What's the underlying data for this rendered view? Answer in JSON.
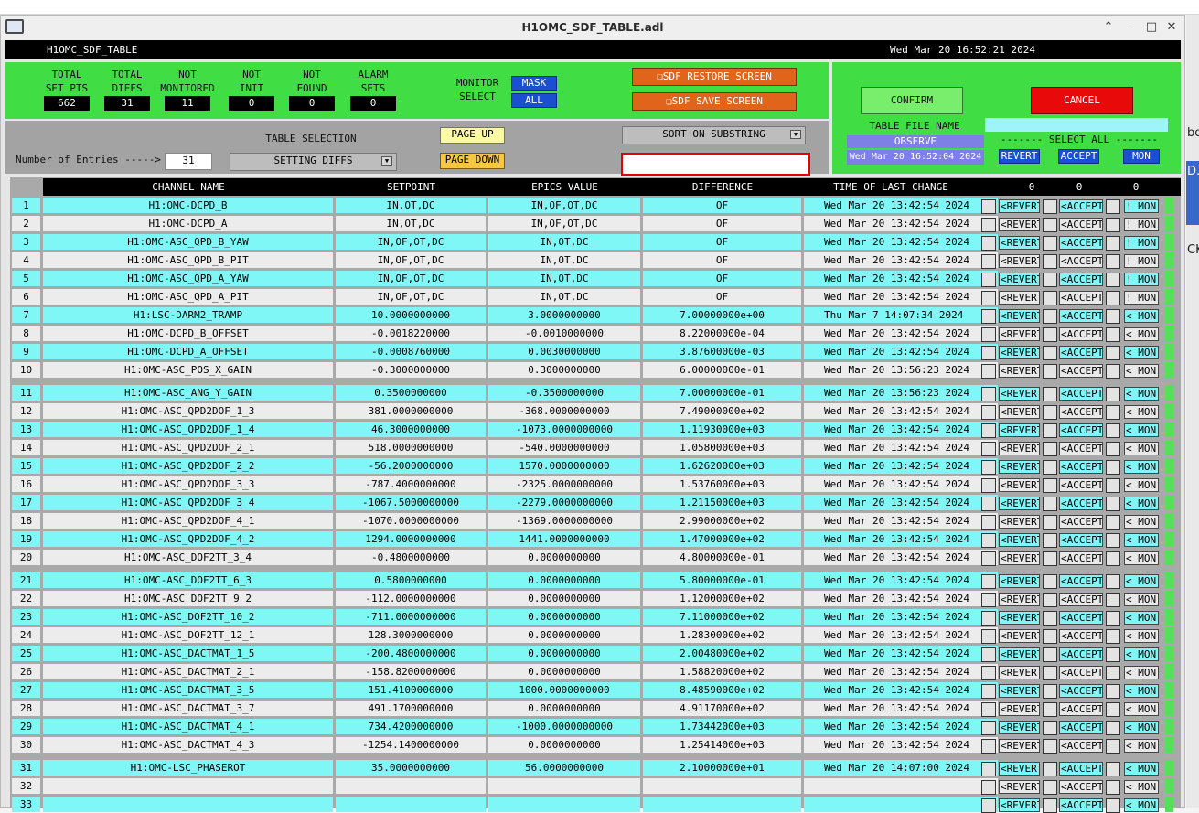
{
  "window": {
    "title": "H1OMC_SDF_TABLE.adl"
  },
  "header": {
    "screen_name": "H1OMC_SDF_TABLE",
    "datetime": "Wed Mar 20 16:52:21 2024"
  },
  "side_fragments": [
    "bo",
    "D.c",
    "CK"
  ],
  "stats": [
    {
      "label1": "TOTAL",
      "label2": "SET PTS",
      "value": "662"
    },
    {
      "label1": "TOTAL",
      "label2": "DIFFS",
      "value": "31"
    },
    {
      "label1": "NOT",
      "label2": "MONITORED",
      "value": "11"
    },
    {
      "label1": "NOT",
      "label2": "INIT",
      "value": "0"
    },
    {
      "label1": "NOT",
      "label2": "FOUND",
      "value": "0"
    },
    {
      "label1": "ALARM",
      "label2": "SETS",
      "value": "0"
    }
  ],
  "monitor": {
    "label1": "MONITOR",
    "label2": "SELECT",
    "mask": "MASK",
    "all": "ALL"
  },
  "buttons": {
    "restore": "SDF RESTORE SCREEN",
    "save": "SDF SAVE SCREEN",
    "confirm": "CONFIRM",
    "cancel": "CANCEL",
    "page_up": "PAGE UP",
    "page_down": "PAGE DOWN"
  },
  "table_file": {
    "label": "TABLE FILE NAME",
    "mode": "OBSERVE",
    "file_time": "Wed Mar 20 16:52:04 2024",
    "value": ""
  },
  "select_all": {
    "label": "------- SELECT ALL -------",
    "revert": "REVERT",
    "accept": "ACCEPT",
    "mon": "MON"
  },
  "table_selection": {
    "label": "TABLE SELECTION",
    "value": "SETTING DIFFS"
  },
  "entries": {
    "label": "Number of Entries ----->",
    "value": "31"
  },
  "sort": {
    "label": "SORT ON SUBSTRING",
    "value": ""
  },
  "columns": {
    "name": "CHANNEL NAME",
    "setpoint": "SETPOINT",
    "epics": "EPICS VALUE",
    "diff": "DIFFERENCE",
    "time": "TIME OF LAST CHANGE",
    "c1": "0",
    "c2": "0",
    "c3": "0"
  },
  "rows": [
    {
      "n": "1",
      "name": "H1:OMC-DCPD_B",
      "sp": "IN,OT,DC",
      "ev": "IN,OF,OT,DC",
      "diff": "OF",
      "time": "Wed Mar 20 13:42:54 2024",
      "mon": "! MON"
    },
    {
      "n": "2",
      "name": "H1:OMC-DCPD_A",
      "sp": "IN,OT,DC",
      "ev": "IN,OF,OT,DC",
      "diff": "OF",
      "time": "Wed Mar 20 13:42:54 2024",
      "mon": "! MON"
    },
    {
      "n": "3",
      "name": "H1:OMC-ASC_QPD_B_YAW",
      "sp": "IN,OF,OT,DC",
      "ev": "IN,OT,DC",
      "diff": "OF",
      "time": "Wed Mar 20 13:42:54 2024",
      "mon": "! MON"
    },
    {
      "n": "4",
      "name": "H1:OMC-ASC_QPD_B_PIT",
      "sp": "IN,OF,OT,DC",
      "ev": "IN,OT,DC",
      "diff": "OF",
      "time": "Wed Mar 20 13:42:54 2024",
      "mon": "! MON"
    },
    {
      "n": "5",
      "name": "H1:OMC-ASC_QPD_A_YAW",
      "sp": "IN,OF,OT,DC",
      "ev": "IN,OT,DC",
      "diff": "OF",
      "time": "Wed Mar 20 13:42:54 2024",
      "mon": "! MON"
    },
    {
      "n": "6",
      "name": "H1:OMC-ASC_QPD_A_PIT",
      "sp": "IN,OF,OT,DC",
      "ev": "IN,OT,DC",
      "diff": "OF",
      "time": "Wed Mar 20 13:42:54 2024",
      "mon": "! MON"
    },
    {
      "n": "7",
      "name": "H1:LSC-DARM2_TRAMP",
      "sp": "10.0000000000",
      "ev": "3.0000000000",
      "diff": "7.00000000e+00",
      "time": "Thu Mar  7 14:07:34 2024",
      "mon": "< MON"
    },
    {
      "n": "8",
      "name": "H1:OMC-DCPD_B_OFFSET",
      "sp": "-0.0018220000",
      "ev": "-0.0010000000",
      "diff": "8.22000000e-04",
      "time": "Wed Mar 20 13:42:54 2024",
      "mon": "< MON"
    },
    {
      "n": "9",
      "name": "H1:OMC-DCPD_A_OFFSET",
      "sp": "-0.0008760000",
      "ev": "0.0030000000",
      "diff": "3.87600000e-03",
      "time": "Wed Mar 20 13:42:54 2024",
      "mon": "< MON"
    },
    {
      "n": "10",
      "name": "H1:OMC-ASC_POS_X_GAIN",
      "sp": "-0.3000000000",
      "ev": "0.3000000000",
      "diff": "6.00000000e-01",
      "time": "Wed Mar 20 13:56:23 2024",
      "mon": "< MON"
    },
    {
      "n": "11",
      "name": "H1:OMC-ASC_ANG_Y_GAIN",
      "sp": "0.3500000000",
      "ev": "-0.3500000000",
      "diff": "7.00000000e-01",
      "time": "Wed Mar 20 13:56:23 2024",
      "mon": "< MON"
    },
    {
      "n": "12",
      "name": "H1:OMC-ASC_QPD2DOF_1_3",
      "sp": "381.0000000000",
      "ev": "-368.0000000000",
      "diff": "7.49000000e+02",
      "time": "Wed Mar 20 13:42:54 2024",
      "mon": "< MON"
    },
    {
      "n": "13",
      "name": "H1:OMC-ASC_QPD2DOF_1_4",
      "sp": "46.3000000000",
      "ev": "-1073.0000000000",
      "diff": "1.11930000e+03",
      "time": "Wed Mar 20 13:42:54 2024",
      "mon": "< MON"
    },
    {
      "n": "14",
      "name": "H1:OMC-ASC_QPD2DOF_2_1",
      "sp": "518.0000000000",
      "ev": "-540.0000000000",
      "diff": "1.05800000e+03",
      "time": "Wed Mar 20 13:42:54 2024",
      "mon": "< MON"
    },
    {
      "n": "15",
      "name": "H1:OMC-ASC_QPD2DOF_2_2",
      "sp": "-56.2000000000",
      "ev": "1570.0000000000",
      "diff": "1.62620000e+03",
      "time": "Wed Mar 20 13:42:54 2024",
      "mon": "< MON"
    },
    {
      "n": "16",
      "name": "H1:OMC-ASC_QPD2DOF_3_3",
      "sp": "-787.4000000000",
      "ev": "-2325.0000000000",
      "diff": "1.53760000e+03",
      "time": "Wed Mar 20 13:42:54 2024",
      "mon": "< MON"
    },
    {
      "n": "17",
      "name": "H1:OMC-ASC_QPD2DOF_3_4",
      "sp": "-1067.5000000000",
      "ev": "-2279.0000000000",
      "diff": "1.21150000e+03",
      "time": "Wed Mar 20 13:42:54 2024",
      "mon": "< MON"
    },
    {
      "n": "18",
      "name": "H1:OMC-ASC_QPD2DOF_4_1",
      "sp": "-1070.0000000000",
      "ev": "-1369.0000000000",
      "diff": "2.99000000e+02",
      "time": "Wed Mar 20 13:42:54 2024",
      "mon": "< MON"
    },
    {
      "n": "19",
      "name": "H1:OMC-ASC_QPD2DOF_4_2",
      "sp": "1294.0000000000",
      "ev": "1441.0000000000",
      "diff": "1.47000000e+02",
      "time": "Wed Mar 20 13:42:54 2024",
      "mon": "< MON"
    },
    {
      "n": "20",
      "name": "H1:OMC-ASC_DOF2TT_3_4",
      "sp": "-0.4800000000",
      "ev": "0.0000000000",
      "diff": "4.80000000e-01",
      "time": "Wed Mar 20 13:42:54 2024",
      "mon": "< MON"
    },
    {
      "n": "21",
      "name": "H1:OMC-ASC_DOF2TT_6_3",
      "sp": "0.5800000000",
      "ev": "0.0000000000",
      "diff": "5.80000000e-01",
      "time": "Wed Mar 20 13:42:54 2024",
      "mon": "< MON"
    },
    {
      "n": "22",
      "name": "H1:OMC-ASC_DOF2TT_9_2",
      "sp": "-112.0000000000",
      "ev": "0.0000000000",
      "diff": "1.12000000e+02",
      "time": "Wed Mar 20 13:42:54 2024",
      "mon": "< MON"
    },
    {
      "n": "23",
      "name": "H1:OMC-ASC_DOF2TT_10_2",
      "sp": "-711.0000000000",
      "ev": "0.0000000000",
      "diff": "7.11000000e+02",
      "time": "Wed Mar 20 13:42:54 2024",
      "mon": "< MON"
    },
    {
      "n": "24",
      "name": "H1:OMC-ASC_DOF2TT_12_1",
      "sp": "128.3000000000",
      "ev": "0.0000000000",
      "diff": "1.28300000e+02",
      "time": "Wed Mar 20 13:42:54 2024",
      "mon": "< MON"
    },
    {
      "n": "25",
      "name": "H1:OMC-ASC_DACTMAT_1_5",
      "sp": "-200.4800000000",
      "ev": "0.0000000000",
      "diff": "2.00480000e+02",
      "time": "Wed Mar 20 13:42:54 2024",
      "mon": "< MON"
    },
    {
      "n": "26",
      "name": "H1:OMC-ASC_DACTMAT_2_1",
      "sp": "-158.8200000000",
      "ev": "0.0000000000",
      "diff": "1.58820000e+02",
      "time": "Wed Mar 20 13:42:54 2024",
      "mon": "< MON"
    },
    {
      "n": "27",
      "name": "H1:OMC-ASC_DACTMAT_3_5",
      "sp": "151.4100000000",
      "ev": "1000.0000000000",
      "diff": "8.48590000e+02",
      "time": "Wed Mar 20 13:42:54 2024",
      "mon": "< MON"
    },
    {
      "n": "28",
      "name": "H1:OMC-ASC_DACTMAT_3_7",
      "sp": "491.1700000000",
      "ev": "0.0000000000",
      "diff": "4.91170000e+02",
      "time": "Wed Mar 20 13:42:54 2024",
      "mon": "< MON"
    },
    {
      "n": "29",
      "name": "H1:OMC-ASC_DACTMAT_4_1",
      "sp": "734.4200000000",
      "ev": "-1000.0000000000",
      "diff": "1.73442000e+03",
      "time": "Wed Mar 20 13:42:54 2024",
      "mon": "< MON"
    },
    {
      "n": "30",
      "name": "H1:OMC-ASC_DACTMAT_4_3",
      "sp": "-1254.1400000000",
      "ev": "0.0000000000",
      "diff": "1.25414000e+03",
      "time": "Wed Mar 20 13:42:54 2024",
      "mon": "< MON"
    },
    {
      "n": "31",
      "name": "H1:OMC-LSC_PHASEROT",
      "sp": "35.0000000000",
      "ev": "56.0000000000",
      "diff": "2.10000000e+01",
      "time": "Wed Mar 20 14:07:00 2024",
      "mon": "< MON"
    },
    {
      "n": "32",
      "name": "",
      "sp": "",
      "ev": "",
      "diff": "",
      "time": "",
      "mon": "< MON"
    },
    {
      "n": "33",
      "name": "",
      "sp": "",
      "ev": "",
      "diff": "",
      "time": "",
      "mon": "< MON"
    }
  ],
  "row_buttons": {
    "revert": "<REVERT",
    "accept": "<ACCEPT"
  },
  "colors": {
    "cyan": "#7ff7f7",
    "light": "#ececec",
    "green": "#41dd45",
    "blue": "#1b4fd3",
    "orange": "#e0641a",
    "red": "#e80a0a"
  }
}
